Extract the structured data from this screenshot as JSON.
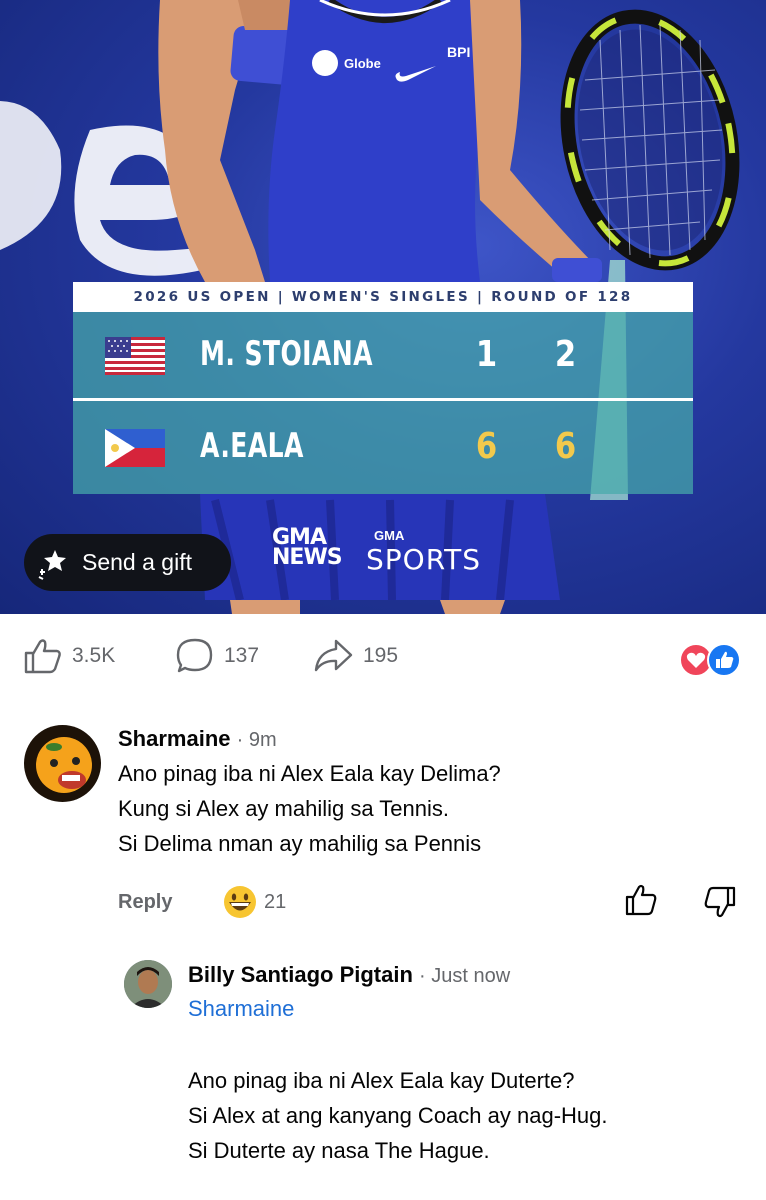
{
  "scoreboard": {
    "header": "2026 US OPEN | WOMEN'S SINGLES | ROUND OF 128",
    "players": [
      {
        "name": "M. STOIANA",
        "flag": "usa-flag",
        "set1": "1",
        "set2": "2",
        "score_color": "#ffffff"
      },
      {
        "name": "A.EALA",
        "flag": "philippines-flag",
        "set1": "6",
        "set2": "6",
        "score_color": "#f2c94c"
      }
    ]
  },
  "hero": {
    "sponsor_left": "Globe",
    "sponsor_right": "BPI",
    "gift_button": "Send a gift",
    "logo_news_top": "GMA",
    "logo_news_bottom": "NEWS",
    "logo_sports_top": "GMA",
    "logo_sports_bottom": "SPORTS"
  },
  "actions": {
    "likes": "3.5K",
    "comments": "137",
    "shares": "195",
    "reaction_icons": [
      "love-icon",
      "like-icon"
    ]
  },
  "comments": [
    {
      "author": "Sharmaine",
      "time": "· 9m",
      "lines": [
        "Ano pinag iba ni Alex Eala kay Delima?",
        "Kung si Alex ay mahilig sa Tennis.",
        "Si Delima nman ay mahilig sa Pennis"
      ],
      "reply_label": "Reply",
      "reaction_emoji": "grinning-emoji",
      "reaction_count": "21"
    },
    {
      "author": "Billy Santiago Pigtain",
      "time": "· Just now",
      "mention": "Sharmaine",
      "lines": [
        "Ano pinag iba ni Alex Eala kay Duterte?",
        "Si Alex at ang kanyang Coach ay nag-Hug.",
        "Si Duterte ay nasa The Hague."
      ]
    }
  ],
  "colors": {
    "accent_blue": "#1877f2",
    "mention_blue": "#1f6fd6",
    "score_teal": "#46aaaa",
    "gift_bg": "#111319"
  }
}
